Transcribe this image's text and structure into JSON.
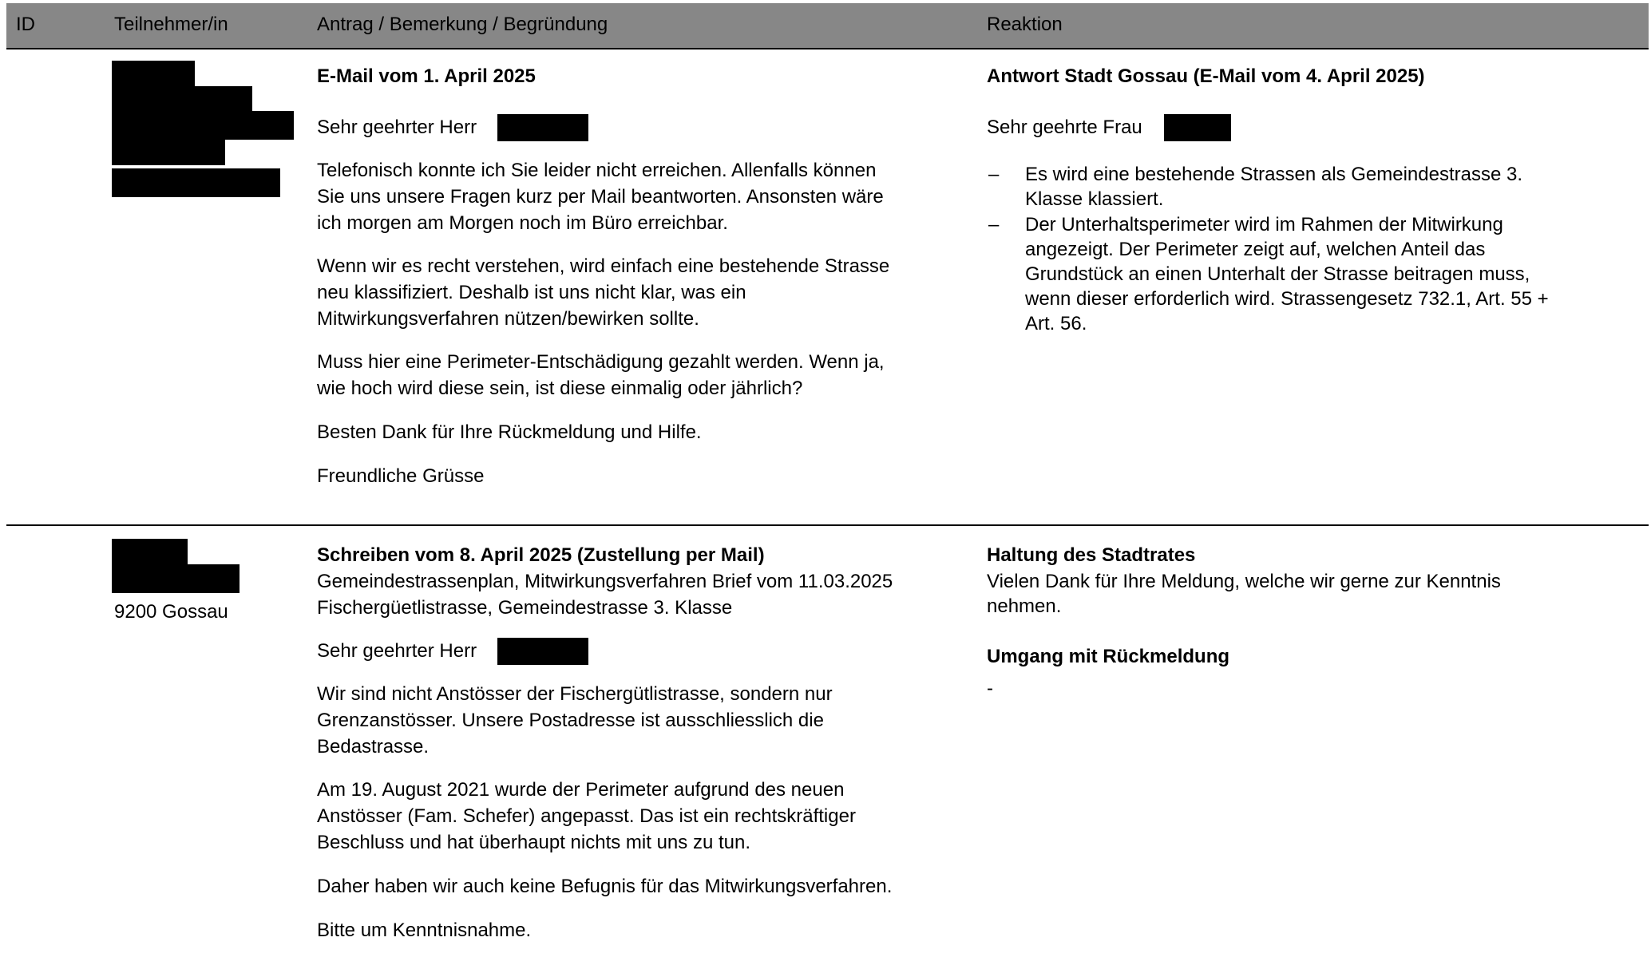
{
  "header": {
    "col_id": "ID",
    "col_participant": "Teilnehmer/in",
    "col_request": "Antrag / Bemerkung / Begründung",
    "col_reaction": "Reaktion"
  },
  "entries": [
    {
      "request": {
        "heading": "E-Mail vom 1. April 2025",
        "salutation": "Sehr geehrter Herr",
        "p1": [
          "Telefonisch konnte ich Sie leider nicht erreichen. Allenfalls können",
          "Sie uns unsere Fragen kurz per Mail beantworten. Ansonsten wäre",
          "ich morgen am Morgen noch im Büro erreichbar."
        ],
        "p2": [
          "Wenn wir es recht verstehen, wird einfach eine bestehende Strasse",
          "neu klassifiziert. Deshalb ist uns nicht klar, was ein",
          "Mitwirkungsverfahren nützen/bewirken sollte."
        ],
        "p3": [
          "Muss hier eine Perimeter-Entschädigung gezahlt werden. Wenn ja,",
          "wie hoch wird diese sein, ist diese einmalig oder jährlich?"
        ],
        "p4": "Besten Dank für Ihre Rückmeldung und Hilfe.",
        "closing": "Freundliche Grüsse"
      },
      "reaction": {
        "heading": "Antwort Stadt Gossau (E-Mail vom 4. April 2025)",
        "salutation": "Sehr geehrte Frau",
        "bullet_symbol": "–",
        "bullet1": [
          "Es wird eine bestehende Strassen als Gemeindestrasse 3.",
          "Klasse klassiert."
        ],
        "bullet2": [
          "Der Unterhaltsperimeter wird im Rahmen der Mitwirkung",
          "angezeigt. Der Perimeter zeigt auf, welchen Anteil das",
          "Grundstück an einen Unterhalt der Strasse beitragen muss,",
          "wenn dieser erforderlich wird. Strassengesetz 732.1, Art. 55 +",
          "Art. 56."
        ]
      }
    },
    {
      "participant": {
        "location": "9200 Gossau"
      },
      "request": {
        "heading": "Schreiben vom 8. April 2025 (Zustellung per Mail)",
        "subject1": "Gemeindestrassenplan, Mitwirkungsverfahren Brief vom 11.03.2025",
        "subject2": "Fischergüetlistrasse, Gemeindestrasse 3. Klasse",
        "salutation": "Sehr geehrter Herr",
        "p1": [
          "Wir sind nicht Anstösser der Fischergütlistrasse, sondern nur",
          "Grenzanstösser. Unsere Postadresse ist ausschliesslich die",
          "Bedastrasse."
        ],
        "p2": [
          "Am 19. August 2021 wurde der Perimeter aufgrund des neuen",
          "Anstösser (Fam. Schefer) angepasst. Das ist ein rechtskräftiger",
          "Beschluss und hat überhaupt nichts mit uns zu tun."
        ],
        "p3": "Daher haben wir auch keine Befugnis für das Mitwirkungsverfahren.",
        "p4": "Bitte um Kenntnisnahme."
      },
      "reaction": {
        "heading1": "Haltung des Stadtrates",
        "text1": [
          "Vielen Dank für Ihre Meldung, welche wir gerne zur Kenntnis",
          "nehmen."
        ],
        "heading2": "Umgang mit Rückmeldung",
        "text2": "-"
      }
    }
  ]
}
